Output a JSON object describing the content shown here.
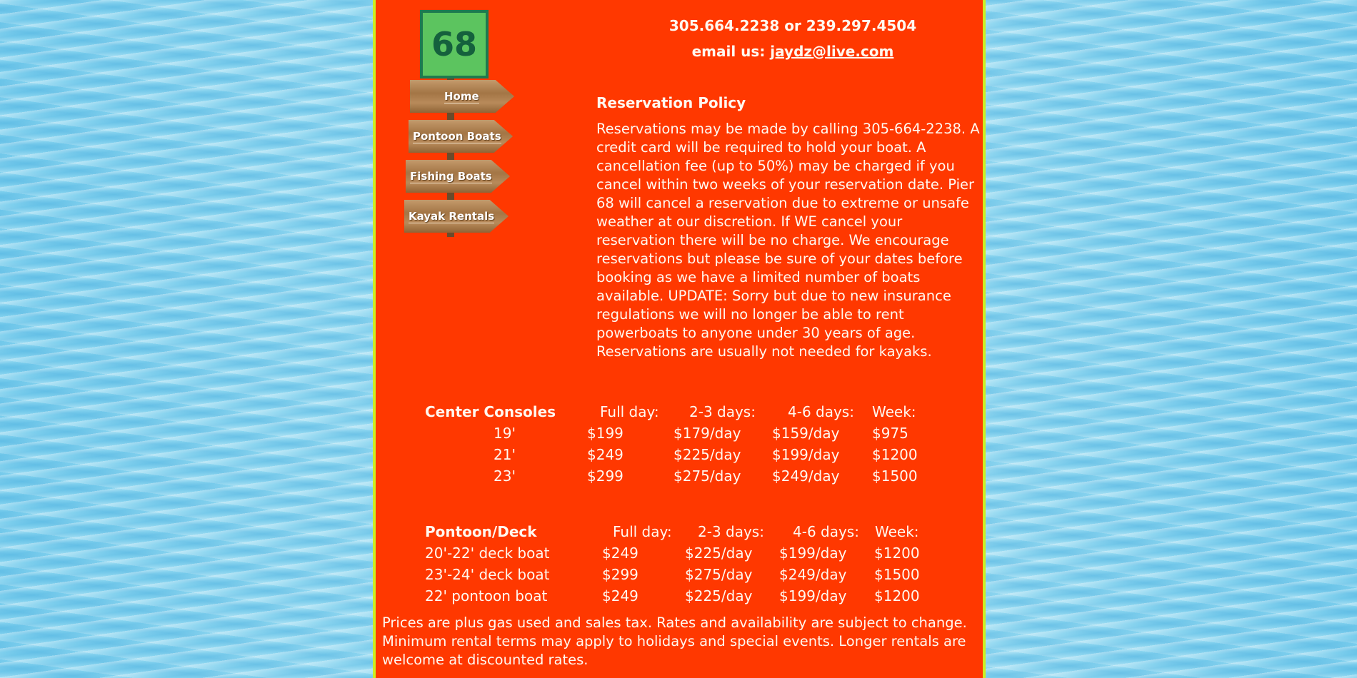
{
  "header": {
    "logo_text": "68",
    "phone": "305.664.2238 or 239.297.4504",
    "email_prefix": "email us:",
    "email": "jaydz@live.com"
  },
  "nav": {
    "items": [
      {
        "label": "Home"
      },
      {
        "label": "Pontoon Boats"
      },
      {
        "label": "Fishing Boats"
      },
      {
        "label": "Kayak Rentals"
      }
    ]
  },
  "policy": {
    "title": "Reservation Policy",
    "body": "Reservations may be made by calling 305-664-2238. A credit card will be required to hold your boat. A cancellation fee (up to 50%) may be charged if you cancel within two weeks of your reservation date. Pier 68 will cancel a reservation due to extreme or unsafe weather at our discretion. If WE cancel your reservation there will be no charge. We encourage reservations but please be sure of your dates before booking as we have a limited number of boats available. UPDATE: Sorry but due to new insurance regulations we will no longer be able to rent powerboats to anyone under 30 years of age. Reservations are usually not needed for kayaks."
  },
  "center_consoles": {
    "headers": [
      "Center Consoles",
      "Full day:",
      "2-3 days:",
      "4-6 days:",
      "Week:"
    ],
    "rows": [
      [
        "19'",
        "$199",
        "$179/day",
        "$159/day",
        "$975"
      ],
      [
        "21'",
        "$249",
        "$225/day",
        "$199/day",
        "$1200"
      ],
      [
        "23'",
        "$299",
        "$275/day",
        "$249/day",
        "$1500"
      ]
    ]
  },
  "pontoon_deck": {
    "headers": [
      "Pontoon/Deck",
      "Full day:",
      "2-3 days:",
      "4-6 days:",
      "Week:"
    ],
    "rows": [
      [
        "20'-22' deck boat",
        "$249",
        "$225/day",
        "$199/day",
        "$1200"
      ],
      [
        "23'-24' deck boat",
        "$299",
        "$275/day",
        "$249/day",
        "$1500"
      ],
      [
        "22' pontoon boat",
        "$249",
        "$225/day",
        "$199/day",
        "$1200"
      ]
    ]
  },
  "footer": {
    "text": "Prices are plus gas used and sales tax. Rates and availability are subject to change. Minimum rental terms may apply to holidays and special events. Longer rentals are welcome at discounted rates."
  }
}
